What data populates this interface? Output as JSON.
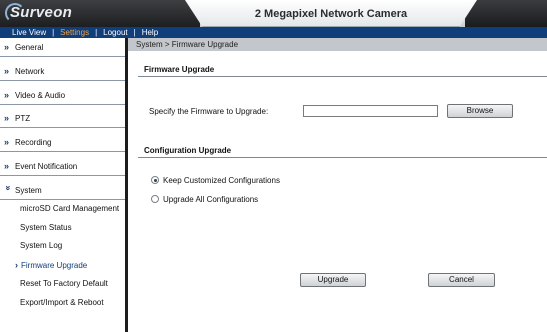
{
  "header": {
    "logo": "Surveon",
    "title": "2 Megapixel Network Camera"
  },
  "navbar": {
    "items": [
      {
        "label": "Live View"
      },
      {
        "label": "Settings",
        "active": true
      },
      {
        "label": "Logout"
      },
      {
        "label": "Help"
      }
    ],
    "separator": "|"
  },
  "sidebar": {
    "items": [
      {
        "label": "General",
        "icon": "double-chevron-right-icon"
      },
      {
        "label": "Network",
        "icon": "double-chevron-right-icon"
      },
      {
        "label": "Video & Audio",
        "icon": "double-chevron-right-icon"
      },
      {
        "label": "PTZ",
        "icon": "double-chevron-right-icon"
      },
      {
        "label": "Recording",
        "icon": "double-chevron-right-icon"
      },
      {
        "label": "Event Notification",
        "icon": "double-chevron-right-icon"
      },
      {
        "label": "System",
        "icon": "double-chevron-down-icon",
        "expanded": true
      }
    ],
    "subitems": [
      {
        "label": "microSD Card Management"
      },
      {
        "label": "System Status"
      },
      {
        "label": "System Log"
      },
      {
        "label": "Firmware Upgrade",
        "active": true
      },
      {
        "label": "Reset To Factory Default"
      },
      {
        "label": "Export/Import & Reboot"
      }
    ]
  },
  "breadcrumb": "System > Firmware Upgrade",
  "firmware": {
    "heading": "Firmware Upgrade",
    "field_label": "Specify the Firmware to Upgrade:",
    "field_value": "",
    "browse_label": "Browse"
  },
  "config": {
    "heading": "Configuration Upgrade",
    "options": [
      {
        "label": "Keep Customized Configurations",
        "checked": true
      },
      {
        "label": "Upgrade All Configurations",
        "checked": false
      }
    ]
  },
  "actions": {
    "upgrade_label": "Upgrade",
    "cancel_label": "Cancel"
  },
  "colors": {
    "navbar_bg": "#0f3e7a",
    "active_nav": "#f3a240",
    "breadcrumb_bg": "#c3c6ca"
  }
}
